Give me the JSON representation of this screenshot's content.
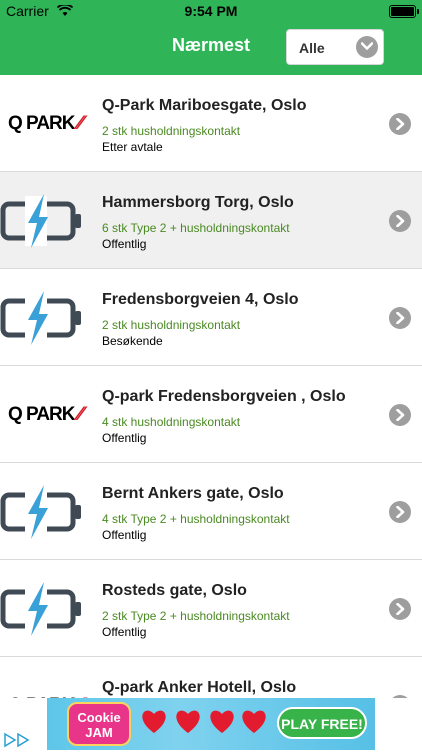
{
  "status_bar": {
    "carrier": "Carrier",
    "time": "9:54 PM",
    "battery_level": 1.0
  },
  "header": {
    "title": "Nærmest",
    "filter_label": "Alle"
  },
  "stations": [
    {
      "icon": "qpark-logo",
      "name": "Q-Park Mariboesgate, Oslo",
      "plugs": "2 stk husholdningskontakt",
      "access": "Etter avtale",
      "highlighted": false
    },
    {
      "icon": "battery-charging-icon",
      "name": "Hammersborg Torg, Oslo",
      "plugs": "6 stk Type 2 + husholdningskontakt",
      "access": "Offentlig",
      "highlighted": true
    },
    {
      "icon": "battery-charging-icon",
      "name": "Fredensborgveien 4, Oslo",
      "plugs": "2 stk husholdningskontakt",
      "access": "Besøkende",
      "highlighted": false
    },
    {
      "icon": "qpark-logo",
      "name": "Q-park Fredensborgveien , Oslo",
      "plugs": "4 stk husholdningskontakt",
      "access": "Offentlig",
      "highlighted": false
    },
    {
      "icon": "battery-charging-icon",
      "name": "Bernt Ankers gate, Oslo",
      "plugs": "4 stk Type 2 + husholdningskontakt",
      "access": "Offentlig",
      "highlighted": false
    },
    {
      "icon": "battery-charging-icon",
      "name": "Rosteds gate, Oslo",
      "plugs": "2 stk Type 2 + husholdningskontakt",
      "access": "Offentlig",
      "highlighted": false
    },
    {
      "icon": "qpark-logo",
      "name": "Q-park Anker Hotell, Oslo",
      "plugs": "",
      "access": "",
      "highlighted": false
    }
  ],
  "qpark_logo_text": "Q PARK",
  "ad": {
    "logo_text": "Cookie JAM",
    "button": "PLAY FREE!"
  },
  "colors": {
    "header_green": "#2fb457",
    "plug_text_green": "#4a8a22",
    "icon_blue": "#3aa0d8",
    "icon_gray": "#3f4a55",
    "arrow_gray": "#9e9e9e"
  }
}
